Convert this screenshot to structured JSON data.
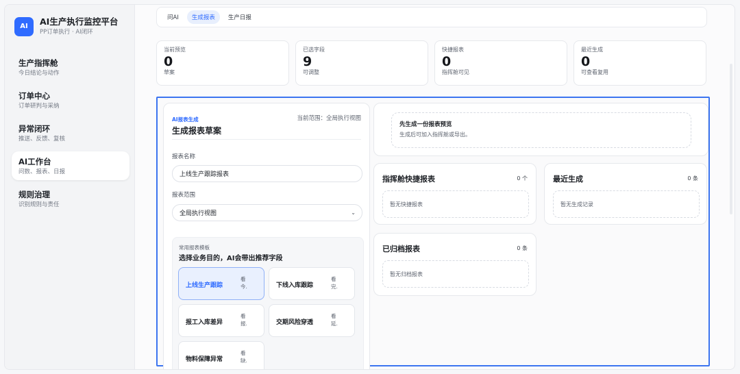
{
  "brand": {
    "logo": "AI",
    "title": "AI生产执行监控平台",
    "subtitle": "PP订单执行 · AI闭环"
  },
  "sidebar": {
    "items": [
      {
        "label": "生产指挥舱",
        "sub": "今日结论与动作"
      },
      {
        "label": "订单中心",
        "sub": "订单研判与采纳"
      },
      {
        "label": "异常闭环",
        "sub": "推送、反馈、复核"
      },
      {
        "label": "AI工作台",
        "sub": "问数、报表、日报",
        "active": true
      },
      {
        "label": "规则治理",
        "sub": "识别规则与责任"
      }
    ]
  },
  "tabs": [
    {
      "label": "问AI"
    },
    {
      "label": "生成报表",
      "active": true
    },
    {
      "label": "生产日报"
    }
  ],
  "stats": [
    {
      "label": "当前预览",
      "value": "0",
      "note": "草案"
    },
    {
      "label": "已选字段",
      "value": "9",
      "note": "可调整"
    },
    {
      "label": "快捷报表",
      "value": "0",
      "note": "指挥舱可见"
    },
    {
      "label": "最近生成",
      "value": "0",
      "note": "可查看复用"
    }
  ],
  "form": {
    "kicker": "AI报表生成",
    "scope": "当前范围：全局执行视图",
    "title": "生成报表草案",
    "name_label": "报表名称",
    "name_value": "上线生产跟踪报表",
    "range_label": "报表范围",
    "range_value": "全局执行视图",
    "templates_kicker": "常用报表模板",
    "templates_title": "选择业务目的，AI会带出推荐字段",
    "templates": [
      {
        "name": "上线生产跟踪",
        "hint": "看今.",
        "active": true
      },
      {
        "name": "下线入库跟踪",
        "hint": "看完."
      },
      {
        "name": "报工入库差异",
        "hint": "看报."
      },
      {
        "name": "交期风险穿透",
        "hint": "看延."
      },
      {
        "name": "物料保障异常",
        "hint": "看缺."
      }
    ]
  },
  "preview": {
    "title": "先生成一份报表预览",
    "sub": "生成后可加入指挥舱或导出。"
  },
  "quick": {
    "title": "指挥舱快捷报表",
    "count": "0 个",
    "empty": "暂无快捷报表"
  },
  "recent": {
    "title": "最近生成",
    "count": "0 条",
    "empty": "暂无生成记录"
  },
  "archived": {
    "title": "已归档报表",
    "count": "0 条",
    "empty": "暂无归档报表"
  }
}
